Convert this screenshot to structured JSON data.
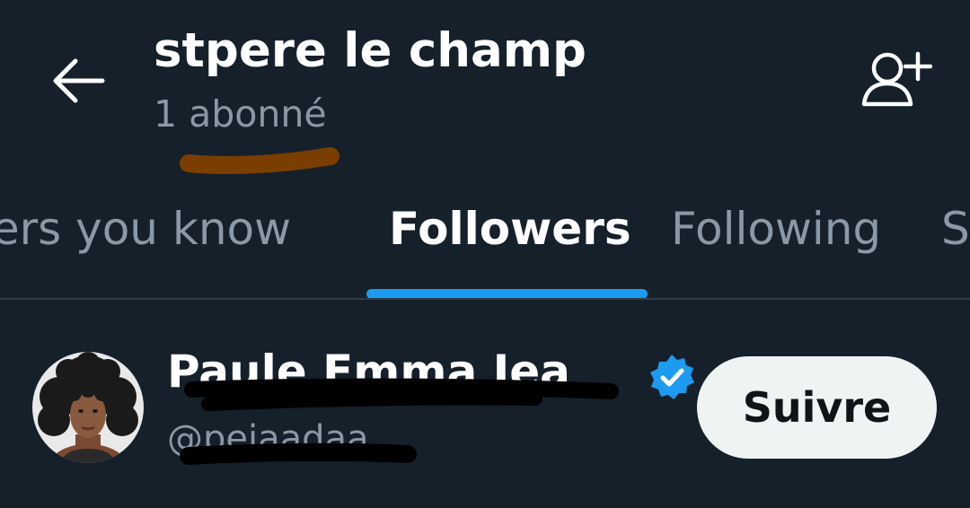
{
  "header": {
    "title": "stpere le champ",
    "subtitle": "1 abonné",
    "back_icon": "arrow-left-icon",
    "add_user_icon": "person-add-icon"
  },
  "tabs": [
    {
      "label": "Followers you know",
      "active": false
    },
    {
      "label": "Followers",
      "active": true
    },
    {
      "label": "Following",
      "active": false
    },
    {
      "label": "S",
      "active": false
    }
  ],
  "follower": {
    "name": "Paule Emma Jea",
    "handle": "@pejaadaa",
    "verified_icon": "verified-badge-icon",
    "follow_label": "Suivre"
  },
  "colors": {
    "background": "#15202b",
    "accent": "#1d9bf0",
    "secondary_text": "#8b98a5",
    "primary_text": "#ffffff",
    "button_bg": "#eff3f4"
  }
}
